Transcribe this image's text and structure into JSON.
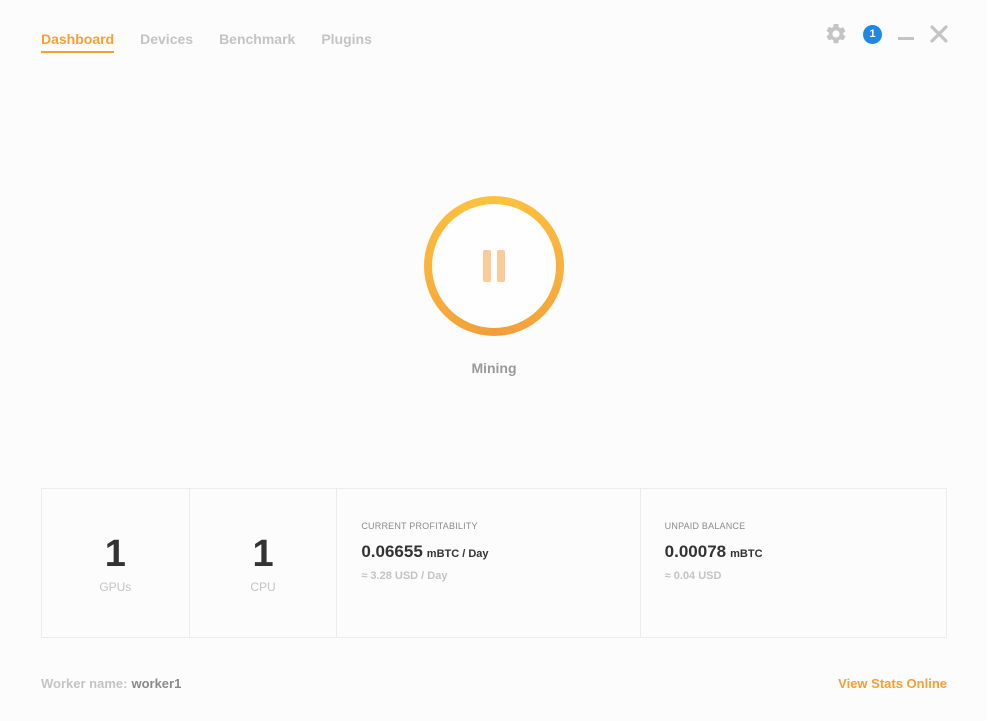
{
  "nav": {
    "tabs": [
      {
        "label": "Dashboard",
        "active": true
      },
      {
        "label": "Devices"
      },
      {
        "label": "Benchmark"
      },
      {
        "label": "Plugins"
      }
    ]
  },
  "controls": {
    "settings_icon": "gear-icon",
    "notification_count": "1",
    "minimize_icon": "minimize-icon",
    "close_icon": "close-icon"
  },
  "mining": {
    "button_icon": "pause-icon",
    "status_label": "Mining"
  },
  "stats": {
    "gpus": {
      "count": "1",
      "label": "GPUs"
    },
    "cpu": {
      "count": "1",
      "label": "CPU"
    },
    "profitability": {
      "heading": "CURRENT PROFITABILITY",
      "value": "0.06655",
      "unit": "mBTC / Day",
      "sub": "≈ 3.28 USD / Day"
    },
    "balance": {
      "heading": "UNPAID BALANCE",
      "value": "0.00078",
      "unit": "mBTC",
      "sub": "≈ 0.04 USD"
    }
  },
  "footer": {
    "worker_label": "Worker name:",
    "worker_name": "worker1",
    "view_stats_link": "View Stats Online"
  },
  "colors": {
    "accent": "#f5a035",
    "badge": "#1e88e5",
    "muted": "#c4c4c4",
    "text": "#333333"
  }
}
